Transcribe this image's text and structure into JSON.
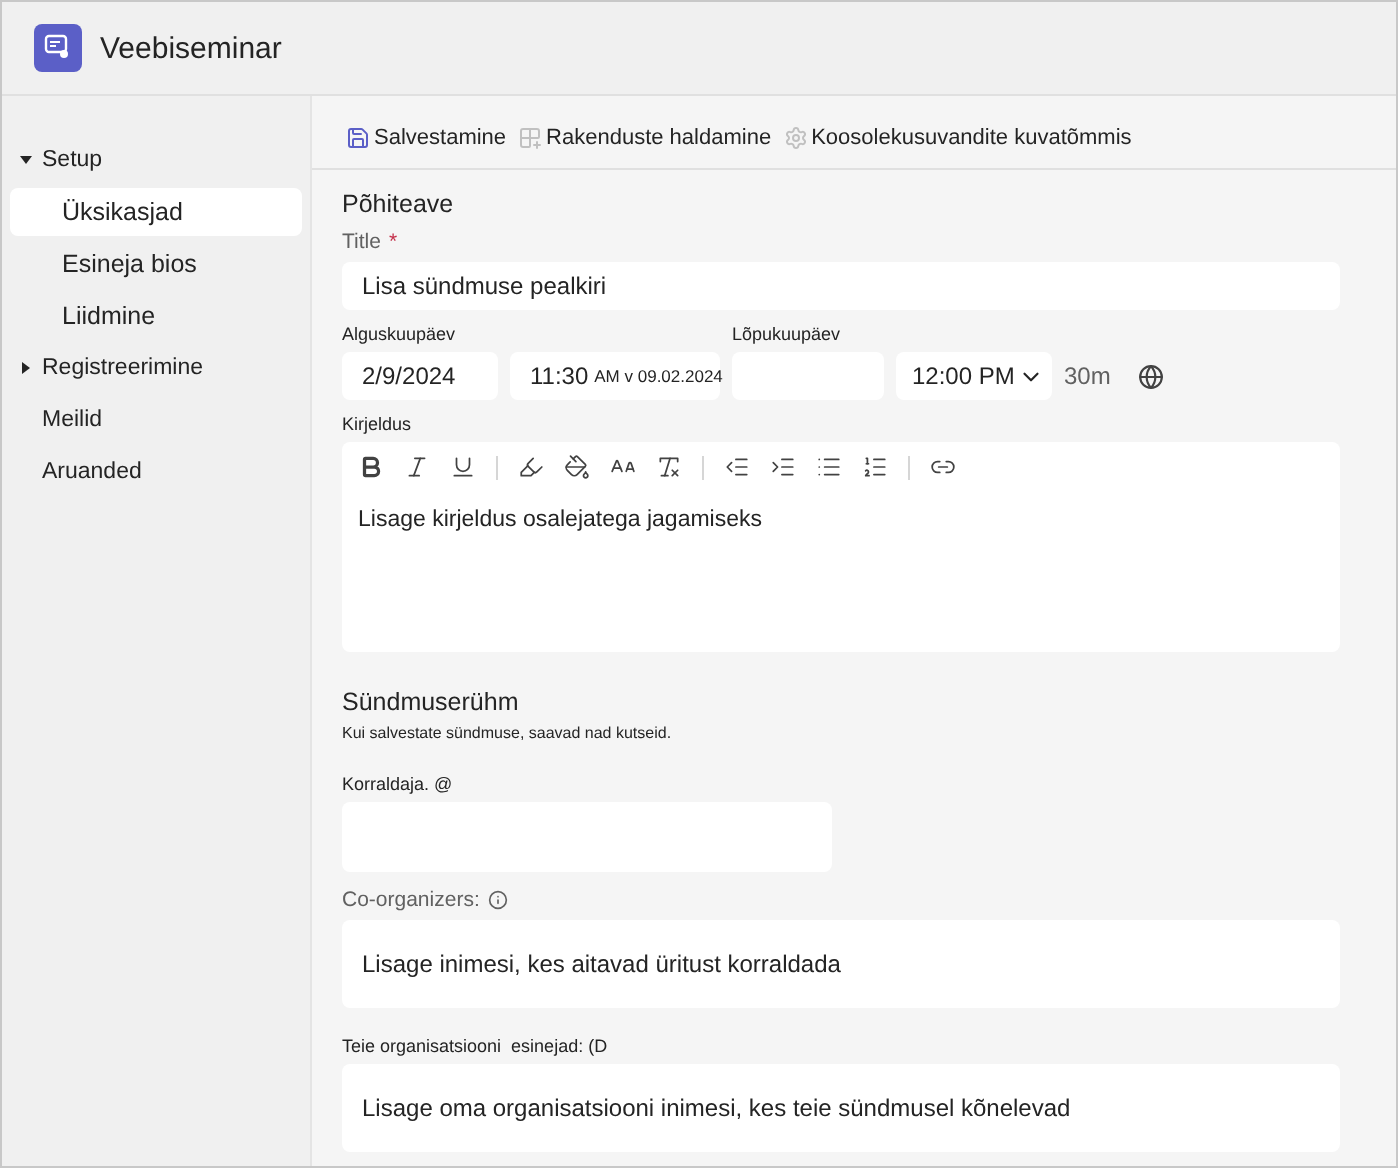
{
  "window": {
    "title": "Veebiseminar"
  },
  "sidebar": {
    "items": [
      {
        "label": "Setup",
        "expanded": true,
        "children": [
          {
            "label": "Üksikasjad",
            "selected": true
          },
          {
            "label": "Esineja bios",
            "selected": false
          },
          {
            "label": "Liidmine",
            "selected": false
          }
        ],
        "selected": false
      },
      {
        "label": "Registreerimine",
        "expanded": false,
        "selected": false
      },
      {
        "label": "Meilid",
        "selected": false
      },
      {
        "label": "Aruanded",
        "selected": false
      }
    ]
  },
  "toolbar": [
    {
      "kind": "save",
      "label": "Salvestamine"
    },
    {
      "kind": "apps",
      "label": "Rakenduste haldamine"
    },
    {
      "kind": "options",
      "label": "Koosolekusuvandite kuvatõmmis"
    }
  ],
  "section_title": "Põhiteave",
  "title_field": {
    "label": "Title",
    "required_mark": "*",
    "placeholder": "Lisa sündmuse pealkiri"
  },
  "start": {
    "label": "Alguskuupäev",
    "date": "2/9/2024",
    "time": "11:30",
    "time_overflow": "AM v 09.02.2024"
  },
  "end": {
    "label": "Lõpukuupäev",
    "time": "12:00 PM",
    "duration": "30m"
  },
  "description": {
    "label": "Kirjeldus",
    "placeholder": "Lisage kirjeldus osalejatega jagamiseks"
  },
  "group": {
    "title": "Sündmuserühm",
    "note": "Kui salvestate sündmuse, saavad nad kutseid.",
    "organizer_label": "Korraldaja. @",
    "coorganizers_label": "Co-organizers:",
    "coorganizers_placeholder": "Lisage inimesi, kes aitavad üritust korraldada",
    "presenters_label": "Teie organisatsiooni  esinejad: (D",
    "presenters_placeholder": "Lisage oma organisatsiooni inimesi, kes teie sündmusel kõnelevad"
  }
}
